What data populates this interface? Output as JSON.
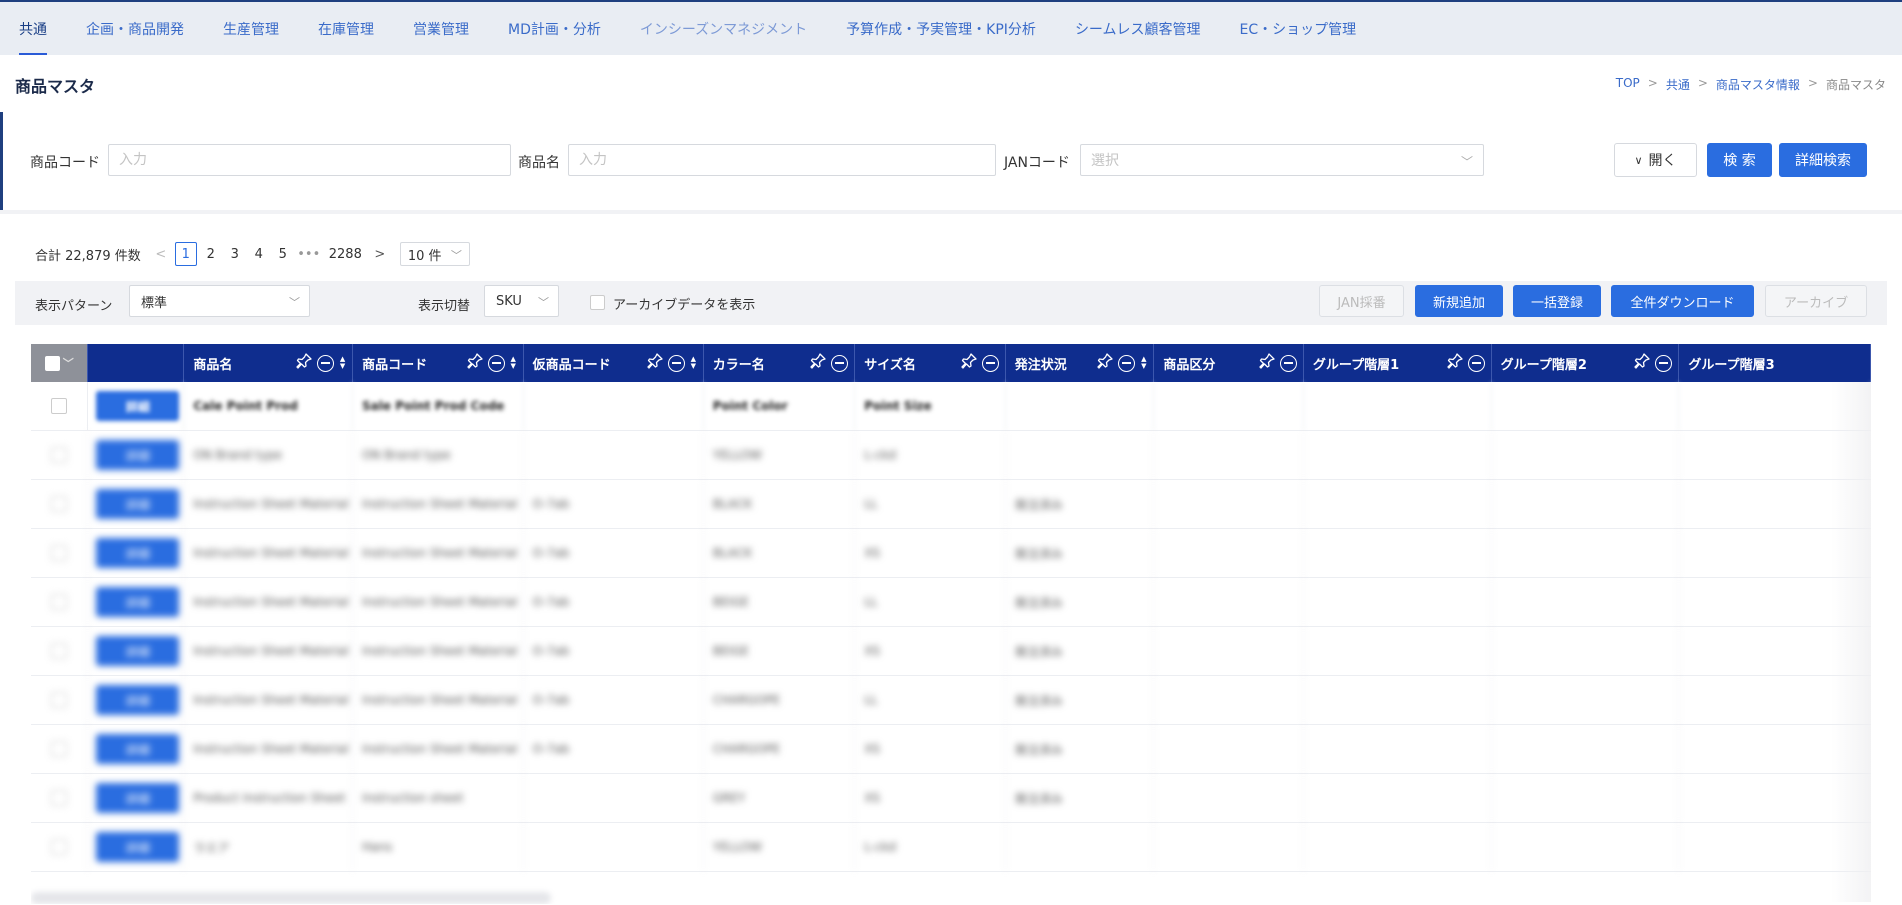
{
  "nav": {
    "items": [
      {
        "label": "共通",
        "state": "active"
      },
      {
        "label": "企画・商品開発",
        "state": "normal"
      },
      {
        "label": "生産管理",
        "state": "normal"
      },
      {
        "label": "在庫管理",
        "state": "normal"
      },
      {
        "label": "営業管理",
        "state": "normal"
      },
      {
        "label": "MD計画・分析",
        "state": "normal"
      },
      {
        "label": "インシーズンマネジメント",
        "state": "muted"
      },
      {
        "label": "予算作成・予実管理・KPI分析",
        "state": "normal"
      },
      {
        "label": "シームレス顧客管理",
        "state": "normal"
      },
      {
        "label": "EC・ショップ管理",
        "state": "normal"
      }
    ]
  },
  "page": {
    "title": "商品マスタ",
    "breadcrumb": [
      "TOP",
      "共通",
      "商品マスタ情報",
      "商品マスタ"
    ],
    "breadcrumb_sep": ">"
  },
  "search": {
    "product_code_label": "商品コード",
    "product_code_placeholder": "入力",
    "product_name_label": "商品名",
    "product_name_placeholder": "入力",
    "jan_label": "JANコード",
    "jan_placeholder": "選択",
    "open_button": "開く",
    "search_button": "検 索",
    "detail_search_button": "詳細検索"
  },
  "pager": {
    "total_text": "合計 22,879 件数",
    "pages": [
      "1",
      "2",
      "3",
      "4",
      "5"
    ],
    "current_page": "1",
    "ellipsis": "•••",
    "last_page": "2288",
    "page_size": "10 件"
  },
  "toolbar": {
    "display_pattern_label": "表示パターン",
    "display_pattern_value": "標準",
    "display_switch_label": "表示切替",
    "display_switch_value": "SKU",
    "archive_label": "アーカイブデータを表示",
    "jan_button": "JAN採番",
    "new_button": "新規追加",
    "bulk_button": "一括登録",
    "download_button": "全件ダウンロード",
    "archive_button": "アーカイブ"
  },
  "table": {
    "columns": [
      {
        "label": "商品名",
        "sortable": true
      },
      {
        "label": "商品コード",
        "sortable": true
      },
      {
        "label": "仮商品コード",
        "sortable": true
      },
      {
        "label": "カラー名",
        "sortable": false
      },
      {
        "label": "サイズ名",
        "sortable": false
      },
      {
        "label": "発注状況",
        "sortable": true
      },
      {
        "label": "商品区分",
        "sortable": false
      },
      {
        "label": "グループ階層1",
        "sortable": false
      },
      {
        "label": "グループ階層2",
        "sortable": false
      },
      {
        "label": "グループ階層3",
        "sortable": false
      }
    ],
    "row_button_label": "詳細",
    "rows": [
      [
        "Cale Point Prod",
        "Sale Point Prod Code",
        "",
        "Point Color",
        "Point Size",
        "",
        "",
        "",
        "",
        ""
      ],
      [
        "ON Brand type",
        "ON Brand type",
        "",
        "YELLOW",
        "L-ckd",
        "",
        "",
        "",
        "",
        ""
      ],
      [
        "Instruction Sheet Material",
        "Instruction Sheet Material",
        "O-7ab",
        "BLACK",
        "LL",
        "発注済み",
        "",
        "",
        "",
        ""
      ],
      [
        "Instruction Sheet Material",
        "Instruction Sheet Material",
        "O-7ab",
        "BLACK",
        "XS",
        "発注済み",
        "",
        "",
        "",
        ""
      ],
      [
        "Instruction Sheet Material",
        "Instruction Sheet Material",
        "O-7ab",
        "BEIGE",
        "LL",
        "発注済み",
        "",
        "",
        "",
        ""
      ],
      [
        "Instruction Sheet Material",
        "Instruction Sheet Material",
        "O-7ab",
        "BEIGE",
        "XS",
        "発注済み",
        "",
        "",
        "",
        ""
      ],
      [
        "Instruction Sheet Material",
        "Instruction Sheet Material",
        "O-7ab",
        "CHARGOPE",
        "LL",
        "発注済み",
        "",
        "",
        "",
        ""
      ],
      [
        "Instruction Sheet Material",
        "Instruction Sheet Material",
        "O-7ab",
        "CHARGOPE",
        "XS",
        "発注済み",
        "",
        "",
        "",
        ""
      ],
      [
        "Product Instruction Sheet",
        "Instruction sheet",
        "",
        "GREY",
        "XS",
        "発注済み",
        "",
        "",
        "",
        ""
      ],
      [
        "ラエア",
        "Hans",
        "",
        "YELLOW",
        "L-ckd",
        "",
        "",
        "",
        "",
        ""
      ]
    ]
  }
}
